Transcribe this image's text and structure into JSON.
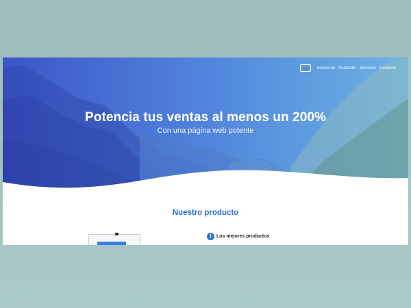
{
  "nav": {
    "links": [
      "Acerca de",
      "Portafolio",
      "Servicios",
      "Contacto"
    ]
  },
  "logo_icon": "logo-icon",
  "hero": {
    "headline": "Potencia tus ventas al menos un 200%",
    "subheadline": "Con una página web potente"
  },
  "section": {
    "title": "Nuestro producto"
  },
  "features": [
    {
      "number": "1",
      "label": "Los mejores productos"
    }
  ],
  "colors": {
    "hero_gradient_start": "#4a63d8",
    "hero_gradient_end": "#6cb0e8",
    "accent": "#2d6bd3",
    "page_background": "#a3c3c2"
  }
}
